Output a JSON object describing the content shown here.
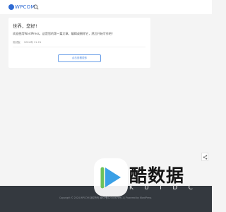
{
  "header": {
    "brand": "WPCOM",
    "search_icon": "search-icon"
  },
  "post": {
    "title": "世界，您好!",
    "excerpt": "欢迎使用WordPress。这是您的第一篇文章。编辑或删除它，然后开始写作吧！",
    "meta_label": "测试板",
    "meta_date": "2024年 11-21"
  },
  "load_more": {
    "label": "点击查看更多"
  },
  "share": {
    "icon": "share-icon"
  },
  "footer": {
    "text": "Copyright © 2024 WPCOM 版权所有 闽ICP备12345678号-1 | Powered by WordPress"
  },
  "watermark": {
    "chars": "酷数据",
    "letters": [
      "K",
      "U",
      "I",
      "D",
      "C"
    ]
  },
  "colors": {
    "brand": "#2f6bd4",
    "button_border": "#6a9fe8",
    "footer_bg": "#34393f",
    "page_bg": "#f4f4f4"
  }
}
